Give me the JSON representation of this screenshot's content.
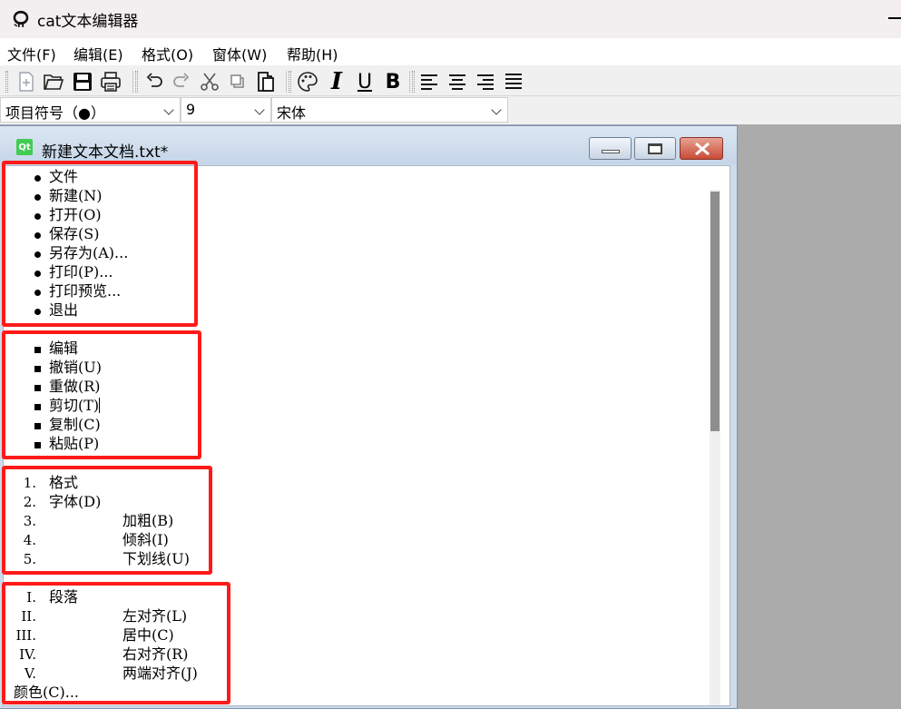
{
  "app": {
    "title": "cat文本编辑器",
    "icon": "github-cat-icon"
  },
  "menu": [
    "文件(F)",
    "编辑(E)",
    "格式(O)",
    "窗体(W)",
    "帮助(H)"
  ],
  "toolbar": {
    "buttons": [
      "new-file-icon",
      "open-folder-icon",
      "save-icon",
      "print-icon",
      "undo-icon",
      "redo-icon",
      "cut-icon",
      "copy-icon",
      "paste-icon",
      "color-palette-icon",
      "italic-icon",
      "underline-icon",
      "bold-icon",
      "align-left-icon",
      "align-center-icon",
      "align-right-icon",
      "justify-icon"
    ],
    "italic_label": "I",
    "underline_label": "U",
    "bold_label": "B"
  },
  "format_bar": {
    "list_style": "项目符号（●）",
    "font_size": "9",
    "font_family": "宋体"
  },
  "document": {
    "title": "新建文本文档.txt*",
    "group1_disc": [
      "文件",
      "新建(N)",
      "打开(O)",
      "保存(S)",
      "另存为(A)...",
      "打印(P)...",
      "打印预览...",
      "退出"
    ],
    "group2_square": [
      "编辑",
      "撤销(U)",
      "重做(R)",
      "剪切(T)",
      "复制(C)",
      "粘贴(P)"
    ],
    "group3_decimal": [
      {
        "marker": "1.",
        "text": "格式"
      },
      {
        "marker": "2.",
        "text": "字体(D)"
      },
      {
        "marker": "3.",
        "text": "加粗(B)"
      },
      {
        "marker": "4.",
        "text": "倾斜(I)"
      },
      {
        "marker": "5.",
        "text": "下划线(U)"
      }
    ],
    "group4_roman": [
      {
        "marker": "I.",
        "text": "段落"
      },
      {
        "marker": "II.",
        "text": "左对齐(L)"
      },
      {
        "marker": "III.",
        "text": "居中(C)"
      },
      {
        "marker": "IV.",
        "text": "右对齐(R)"
      },
      {
        "marker": "V.",
        "text": "两端对齐(J)"
      }
    ],
    "trailing_line": "颜色(C)..."
  },
  "colors": {
    "highlight_box": "#ff1a1a",
    "mdi_background": "#ababab",
    "qt_green": "#41cd52"
  }
}
